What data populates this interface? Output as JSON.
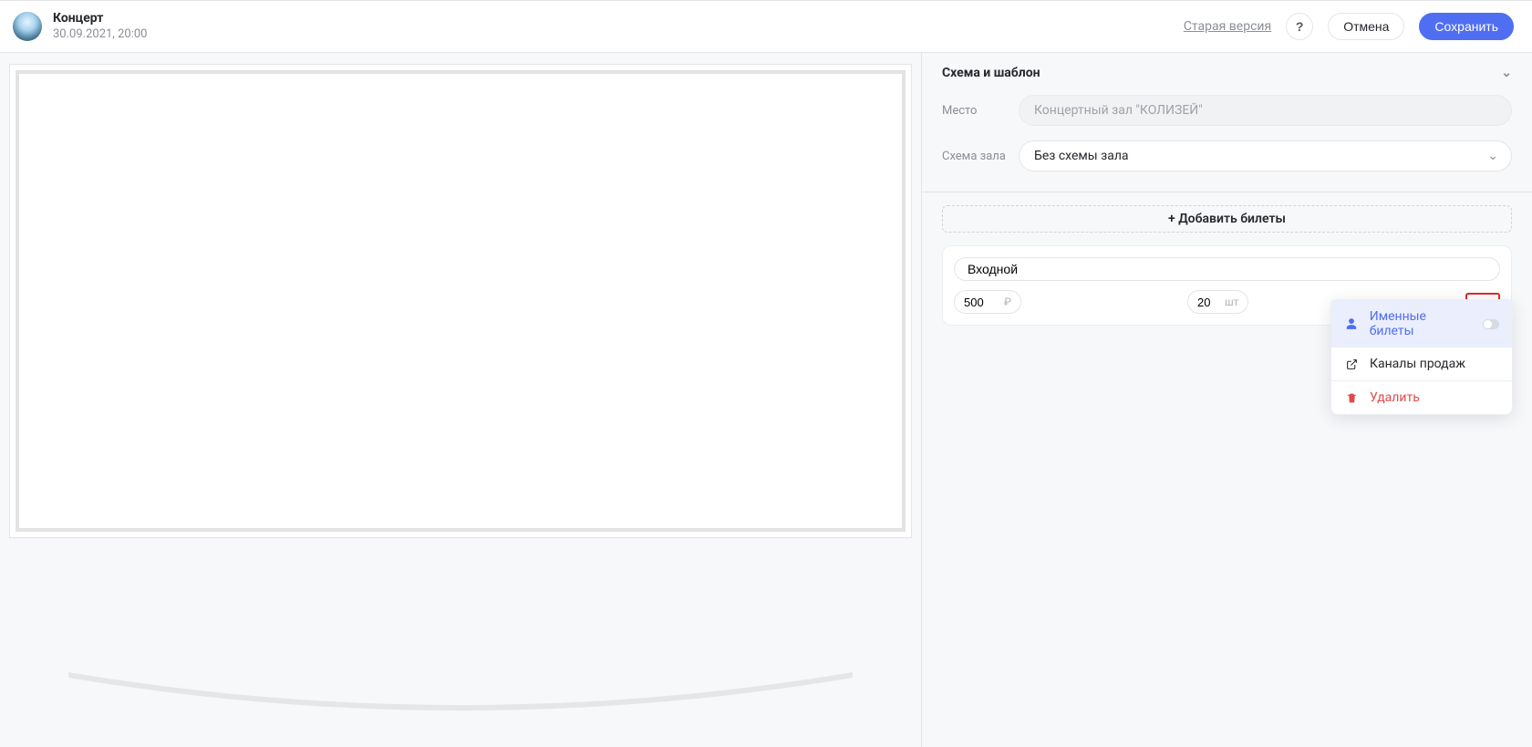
{
  "header": {
    "title": "Концерт",
    "datetime": "30.09.2021, 20:00",
    "old_version_label": "Старая версия",
    "help_label": "?",
    "cancel_label": "Отмена",
    "save_label": "Сохранить"
  },
  "panel": {
    "title": "Схема и шаблон",
    "place_label": "Место",
    "place_value": "Концертный зал \"КОЛИЗЕЙ\"",
    "scheme_label": "Схема зала",
    "scheme_value": "Без схемы зала"
  },
  "tickets": {
    "add_label": "+ Добавить билеты",
    "card": {
      "name": "Входной",
      "price": "500",
      "currency": "₽",
      "qty": "20",
      "qty_unit": "шт",
      "more": "..."
    }
  },
  "dropdown": {
    "named": "Именные билеты",
    "channels": "Каналы продаж",
    "delete": "Удалить"
  }
}
